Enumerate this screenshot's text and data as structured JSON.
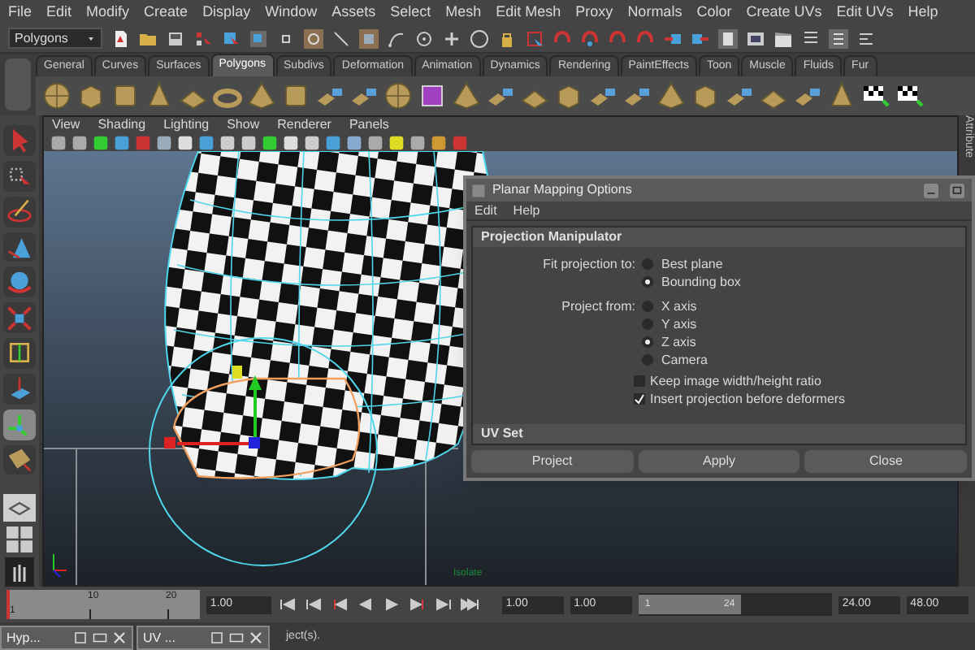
{
  "menu_bar": [
    "File",
    "Edit",
    "Modify",
    "Create",
    "Display",
    "Window",
    "Assets",
    "Select",
    "Mesh",
    "Edit Mesh",
    "Proxy",
    "Normals",
    "Color",
    "Create UVs",
    "Edit UVs",
    "Help"
  ],
  "mode_menu": "Polygons",
  "shelf_tabs": [
    {
      "label": "General",
      "selected": false
    },
    {
      "label": "Curves",
      "selected": false
    },
    {
      "label": "Surfaces",
      "selected": false
    },
    {
      "label": "Polygons",
      "selected": true
    },
    {
      "label": "Subdivs",
      "selected": false
    },
    {
      "label": "Deformation",
      "selected": false
    },
    {
      "label": "Animation",
      "selected": false
    },
    {
      "label": "Dynamics",
      "selected": false
    },
    {
      "label": "Rendering",
      "selected": false
    },
    {
      "label": "PaintEffects",
      "selected": false
    },
    {
      "label": "Toon",
      "selected": false
    },
    {
      "label": "Muscle",
      "selected": false
    },
    {
      "label": "Fluids",
      "selected": false
    },
    {
      "label": "Fur",
      "selected": false
    }
  ],
  "viewport_menu": [
    "View",
    "Shading",
    "Lighting",
    "Show",
    "Renderer",
    "Panels"
  ],
  "viewport_label": "Isolate",
  "attribute_strip": "Attribute",
  "dialog": {
    "title": "Planar Mapping Options",
    "menu": [
      "Edit",
      "Help"
    ],
    "section": "Projection Manipulator",
    "fit_projection": {
      "label": "Fit projection to:",
      "options": [
        {
          "label": "Best plane",
          "selected": false
        },
        {
          "label": "Bounding box",
          "selected": true
        }
      ]
    },
    "project_from": {
      "label": "Project from:",
      "options": [
        {
          "label": "X axis",
          "selected": false
        },
        {
          "label": "Y axis",
          "selected": false
        },
        {
          "label": "Z axis",
          "selected": true
        },
        {
          "label": "Camera",
          "selected": false
        }
      ]
    },
    "checkboxes": [
      {
        "label": "Keep image width/height ratio",
        "checked": false
      },
      {
        "label": "Insert projection before deformers",
        "checked": true
      }
    ],
    "section_2": "UV Set",
    "buttons": [
      "Project",
      "Apply",
      "Close"
    ]
  },
  "timeline": {
    "ticks": [
      "1",
      "10",
      "20"
    ],
    "current_time": "1.00",
    "level": 0
  },
  "range": {
    "start_time": "1.00",
    "playback_start": "1.00",
    "slider_start": "1",
    "slider_end": "24",
    "level": 0.53,
    "playback_end": "24.00",
    "end_time": "48.00"
  },
  "status_text": "ject(s).",
  "minimized_windows": [
    "Hyp...",
    "UV ..."
  ]
}
